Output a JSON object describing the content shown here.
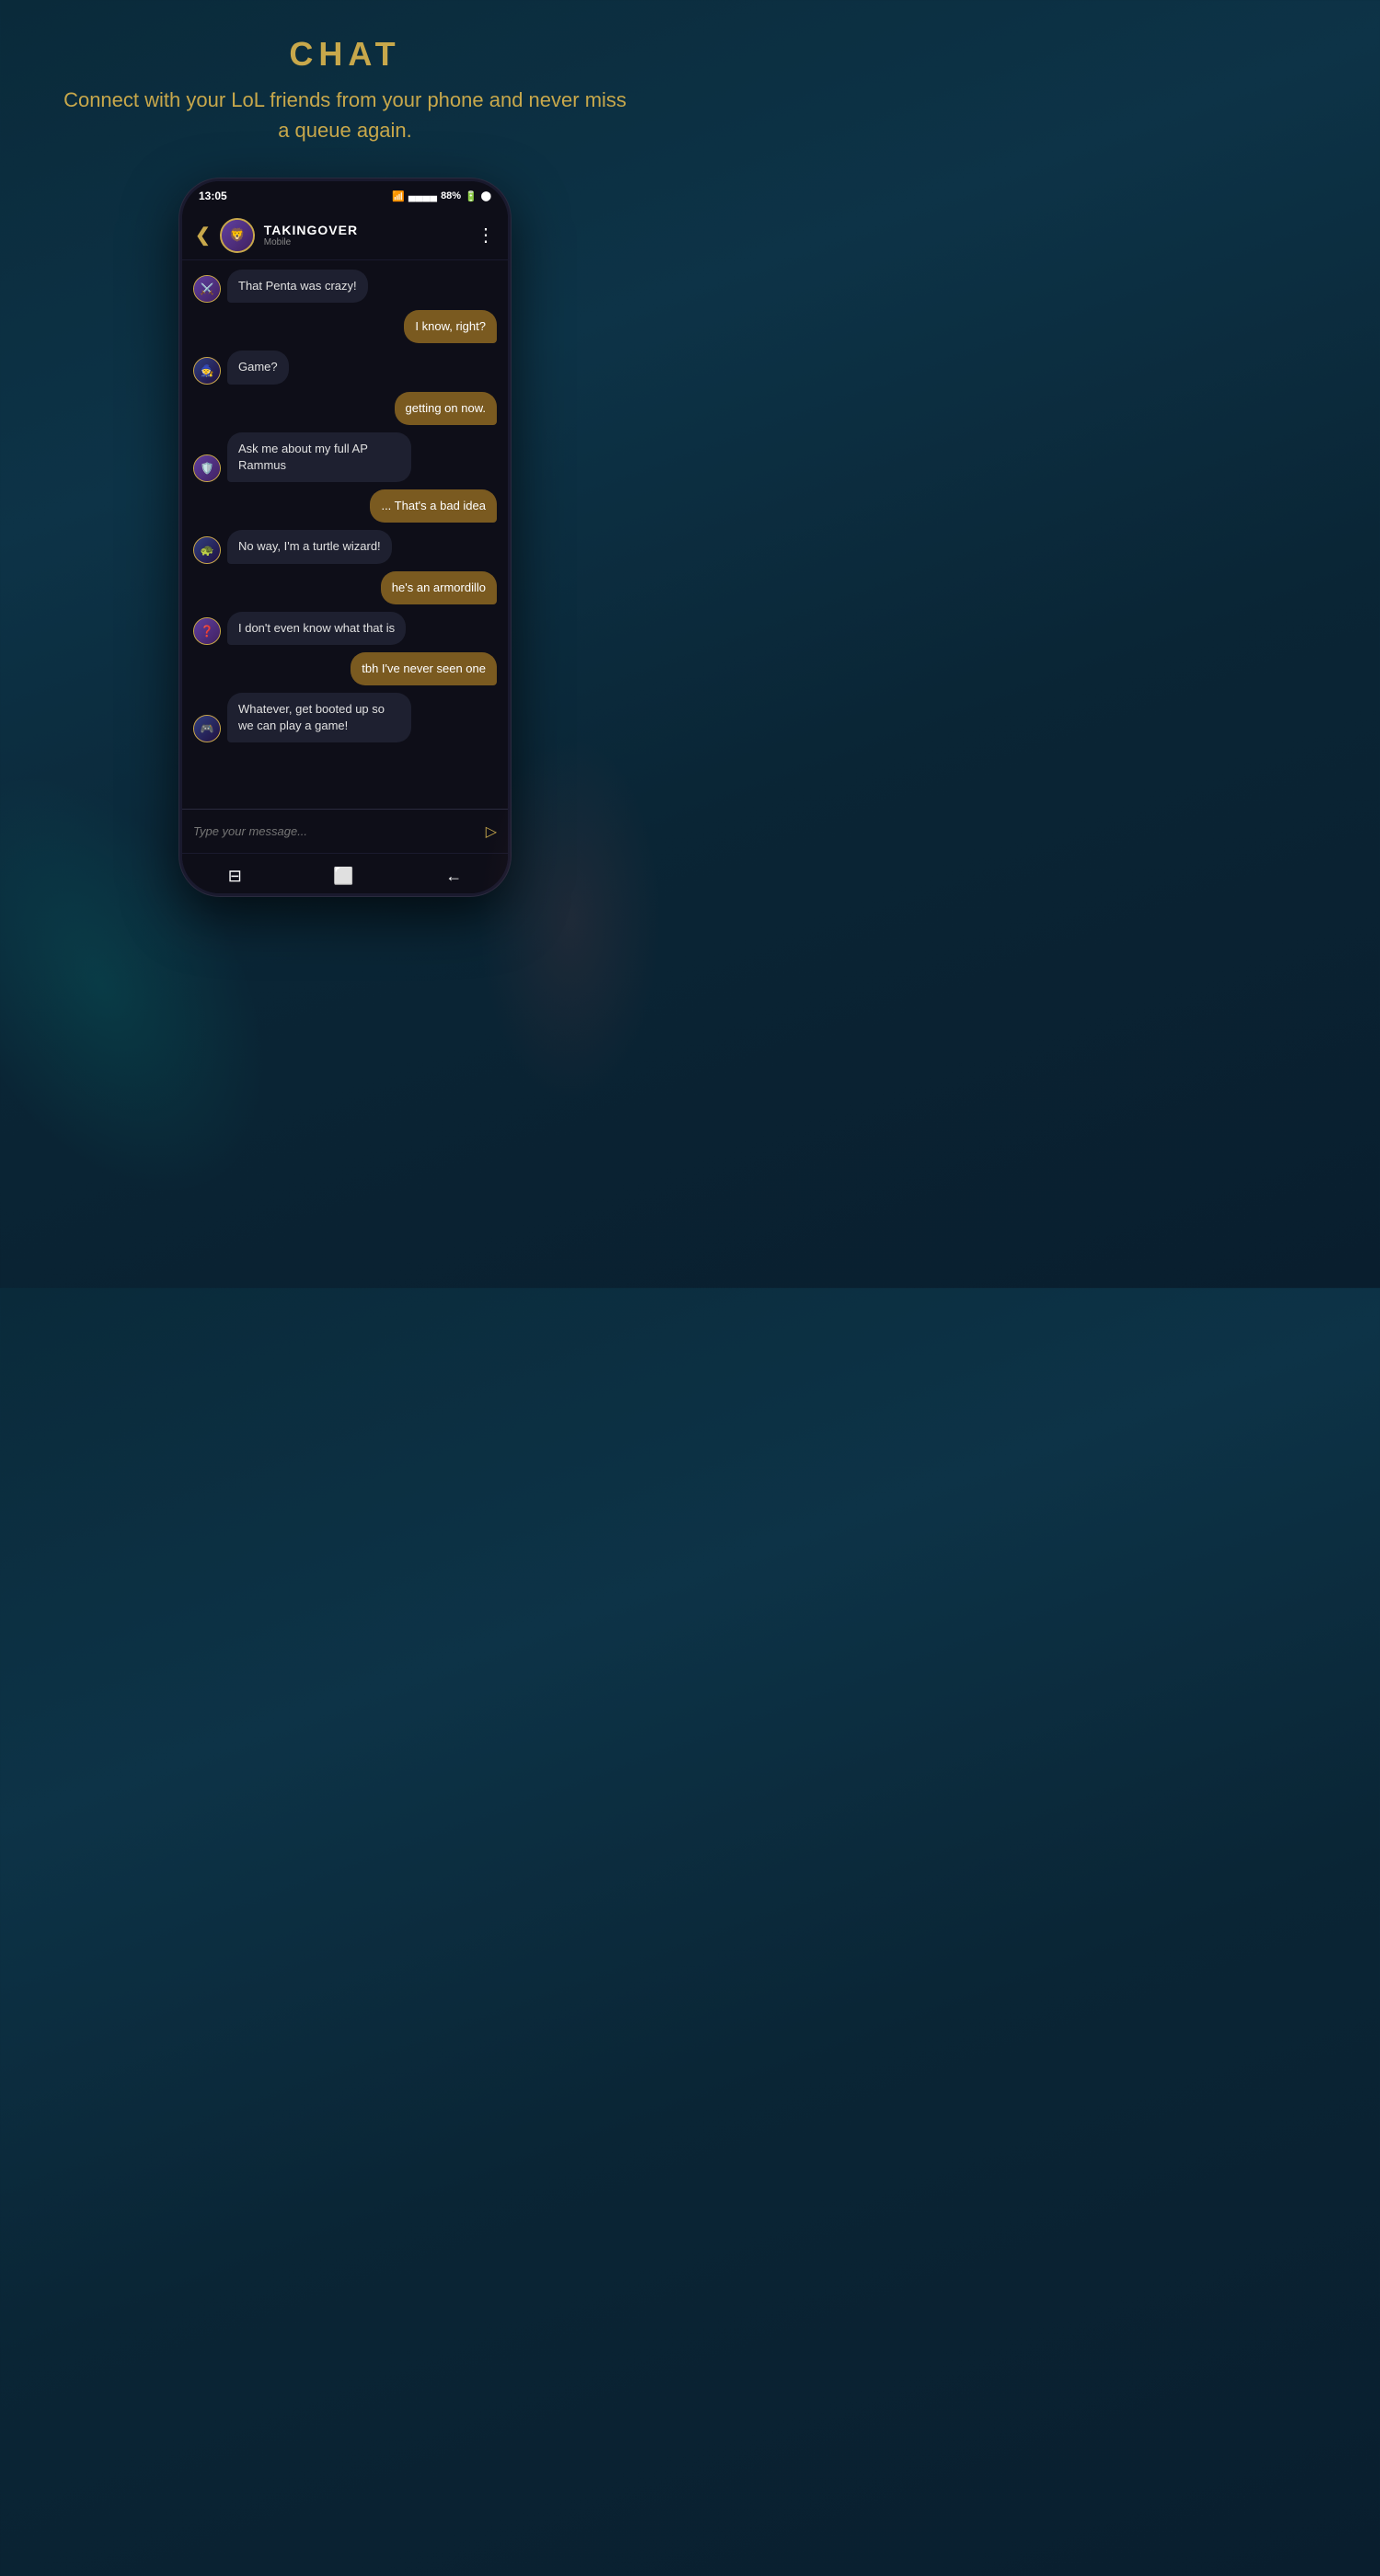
{
  "page": {
    "title": "CHAT",
    "subtitle": "Connect with your LoL friends from your phone and never miss a queue again."
  },
  "status_bar": {
    "time": "13:05",
    "wifi": "WiFi",
    "signal": "▲▲▲▲",
    "battery": "88%"
  },
  "chat_header": {
    "back_label": "❮",
    "contact_name": "TAKINGOVER",
    "contact_status": "Mobile",
    "more_label": "⋮"
  },
  "messages": [
    {
      "id": 1,
      "type": "received",
      "text": "That Penta was crazy!",
      "show_avatar": true
    },
    {
      "id": 2,
      "type": "sent",
      "text": "I know, right?"
    },
    {
      "id": 3,
      "type": "received",
      "text": "Game?",
      "show_avatar": true
    },
    {
      "id": 4,
      "type": "sent",
      "text": "getting on now."
    },
    {
      "id": 5,
      "type": "received",
      "text": "Ask me about my full AP Rammus",
      "show_avatar": true
    },
    {
      "id": 6,
      "type": "sent",
      "text": "... That's a bad idea"
    },
    {
      "id": 7,
      "type": "received",
      "text": "No way, I'm a turtle wizard!",
      "show_avatar": true
    },
    {
      "id": 8,
      "type": "sent",
      "text": "he's an armordillo"
    },
    {
      "id": 9,
      "type": "received",
      "text": "I don't even know what that is",
      "show_avatar": true
    },
    {
      "id": 10,
      "type": "sent",
      "text": "tbh I've never seen one"
    },
    {
      "id": 11,
      "type": "received",
      "text": "Whatever, get booted up so we can play a game!",
      "show_avatar": true
    }
  ],
  "input": {
    "placeholder": "Type your message...",
    "send_icon": "▷"
  },
  "bottom_nav": {
    "recent_icon": "⎕",
    "home_icon": "○",
    "back_icon": "←"
  }
}
